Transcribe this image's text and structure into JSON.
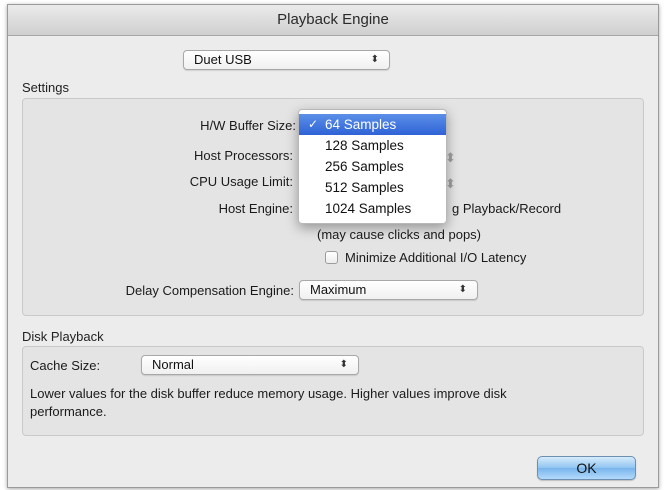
{
  "window": {
    "title": "Playback Engine"
  },
  "device": {
    "selected": "Duet USB"
  },
  "settings": {
    "section_label": "Settings",
    "hw_buffer_size_label": "H/W Buffer Size:",
    "host_processors_label": "Host Processors:",
    "cpu_usage_limit_label": "CPU Usage Limit:",
    "host_engine_label": "Host Engine:",
    "host_engine_text_fragment": "g Playback/Record",
    "host_engine_note": "(may cause clicks and pops)",
    "minimize_latency_label": "Minimize Additional I/O Latency",
    "delay_comp_label": "Delay Compensation Engine:",
    "delay_comp_value": "Maximum"
  },
  "buffer_menu": {
    "items": [
      "64 Samples",
      "128 Samples",
      "256 Samples",
      "512 Samples",
      "1024 Samples"
    ],
    "selected_index": 0,
    "check_glyph": "✓"
  },
  "disk_playback": {
    "section_label": "Disk Playback",
    "cache_size_label": "Cache Size:",
    "cache_size_value": "Normal",
    "description_line1": "Lower values for the disk buffer reduce memory usage.  Higher values improve disk",
    "description_line2": "performance."
  },
  "buttons": {
    "ok_label": "OK"
  },
  "icons": {
    "popup_arrows": "updown-arrows-icon"
  }
}
